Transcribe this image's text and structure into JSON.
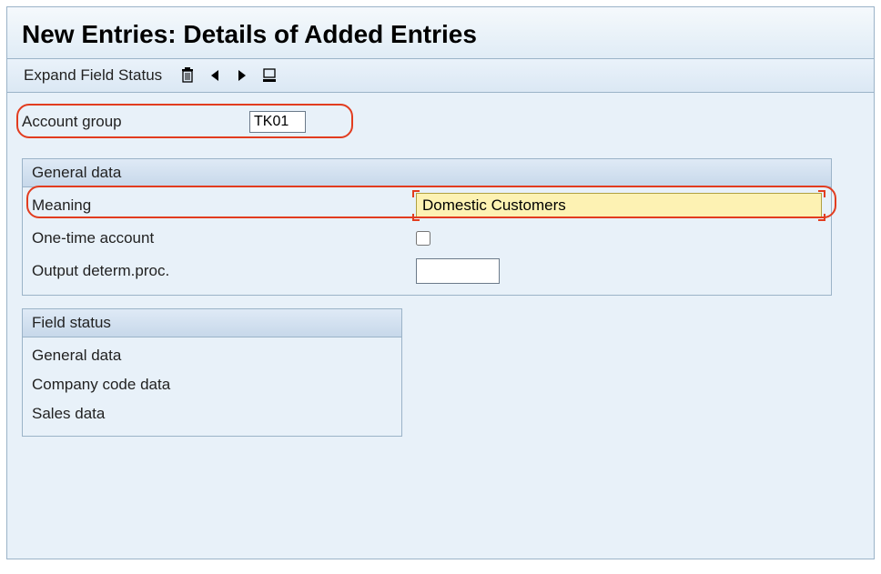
{
  "title": "New Entries: Details of Added Entries",
  "toolbar": {
    "expand_label": "Expand Field Status"
  },
  "account_group": {
    "label": "Account group",
    "value": "TK01"
  },
  "general_data": {
    "header": "General data",
    "meaning": {
      "label": "Meaning",
      "value": "Domestic Customers"
    },
    "one_time": {
      "label": "One-time account",
      "checked": false
    },
    "output_determ": {
      "label": "Output determ.proc.",
      "value": ""
    }
  },
  "field_status": {
    "header": "Field status",
    "items": [
      "General data",
      "Company code data",
      "Sales data"
    ]
  }
}
